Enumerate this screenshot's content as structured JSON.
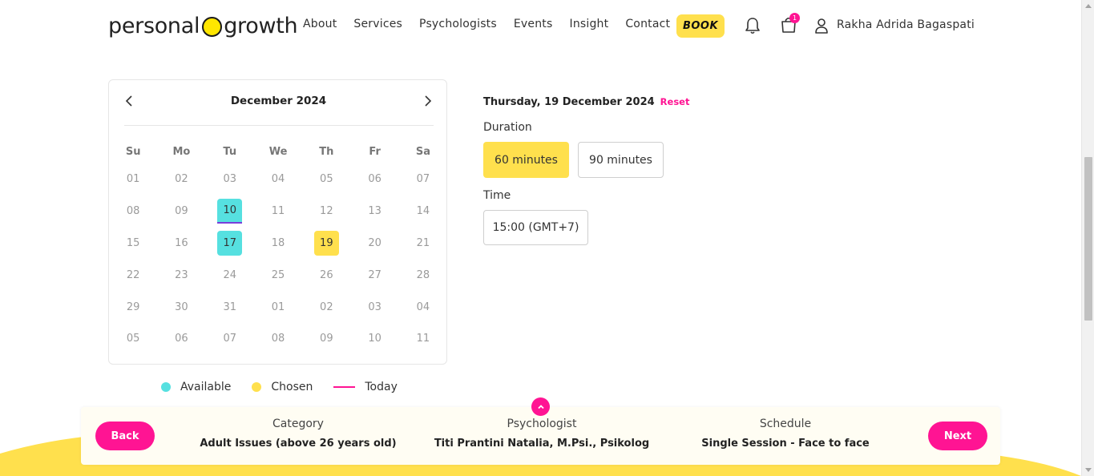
{
  "header": {
    "logo_left": "personal",
    "logo_right": "growth",
    "nav": [
      "About",
      "Services",
      "Psychologists",
      "Events",
      "Insight",
      "Contact"
    ],
    "book_label": "BOOK",
    "cart_count": "1",
    "user_name": "Rakha Adrida Bagaspati"
  },
  "calendar": {
    "title": "December 2024",
    "weekdays": [
      "Su",
      "Mo",
      "Tu",
      "We",
      "Th",
      "Fr",
      "Sa"
    ],
    "weeks": [
      [
        {
          "d": "01"
        },
        {
          "d": "02"
        },
        {
          "d": "03"
        },
        {
          "d": "04"
        },
        {
          "d": "05"
        },
        {
          "d": "06"
        },
        {
          "d": "07"
        }
      ],
      [
        {
          "d": "08"
        },
        {
          "d": "09"
        },
        {
          "d": "10",
          "s": "available today"
        },
        {
          "d": "11"
        },
        {
          "d": "12"
        },
        {
          "d": "13"
        },
        {
          "d": "14"
        }
      ],
      [
        {
          "d": "15"
        },
        {
          "d": "16"
        },
        {
          "d": "17",
          "s": "available"
        },
        {
          "d": "18"
        },
        {
          "d": "19",
          "s": "chosen"
        },
        {
          "d": "20"
        },
        {
          "d": "21"
        }
      ],
      [
        {
          "d": "22"
        },
        {
          "d": "23"
        },
        {
          "d": "24"
        },
        {
          "d": "25"
        },
        {
          "d": "26"
        },
        {
          "d": "27"
        },
        {
          "d": "28"
        }
      ],
      [
        {
          "d": "29"
        },
        {
          "d": "30"
        },
        {
          "d": "31"
        },
        {
          "d": "01"
        },
        {
          "d": "02"
        },
        {
          "d": "03"
        },
        {
          "d": "04"
        }
      ],
      [
        {
          "d": "05"
        },
        {
          "d": "06"
        },
        {
          "d": "07"
        },
        {
          "d": "08"
        },
        {
          "d": "09"
        },
        {
          "d": "10"
        },
        {
          "d": "11"
        }
      ]
    ]
  },
  "legend": {
    "available": "Available",
    "chosen": "Chosen",
    "today": "Today"
  },
  "booking": {
    "selected_date": "Thursday, 19 December 2024",
    "reset_label": "Reset",
    "duration_label": "Duration",
    "duration_60": "60 minutes",
    "duration_90": "90 minutes",
    "time_label": "Time",
    "time_slot": "15:00 (GMT+7)"
  },
  "bottom_bar": {
    "back_label": "Back",
    "next_label": "Next",
    "category_label": "Category",
    "category_value": "Adult Issues (above 26 years old)",
    "psychologist_label": "Psychologist",
    "psychologist_value": "Titi Prantini Natalia, M.Psi., Psikolog",
    "schedule_label": "Schedule",
    "schedule_value": "Single Session - Face to face"
  },
  "colors": {
    "accent_pink": "#ff1493",
    "accent_yellow": "#ffe04d",
    "available_cyan": "#56e0e0"
  }
}
